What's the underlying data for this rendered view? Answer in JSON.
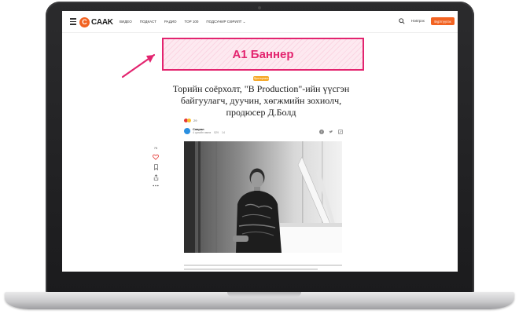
{
  "site": {
    "logo_letter": "C",
    "logo_text": "CAAK",
    "brand_color": "#f26322",
    "nav": [
      "Видео",
      "Подкаст",
      "Радио",
      "Top 100",
      "Подсунир Сөрилт ⌄"
    ],
    "login_label": "Нэвтрэх",
    "cta_label": "Бүртгүүлэх",
    "menu_icon": "hamburger-icon",
    "search_icon": "search-icon"
  },
  "banner": {
    "label": "A1 Баннер",
    "accent": "#e3246f"
  },
  "article": {
    "category": "Ярилцлага",
    "headline": "Торийн соёрхолт, \"B Production\"-ийн үүсгэн байгуулагч, дуучин, хөгжмийн зохиолч, продюсер Д.Болд",
    "reaction_count": "29",
    "author_name": "Саарал",
    "author_time": "4 цагийн өмнө",
    "views": "529",
    "comments": "14"
  },
  "sidebar": {
    "count": "75",
    "icons": [
      "heart-icon",
      "bookmark-icon",
      "share-icon",
      "more-icon"
    ]
  },
  "share_icons": [
    "facebook-icon",
    "twitter-icon",
    "link-icon"
  ]
}
